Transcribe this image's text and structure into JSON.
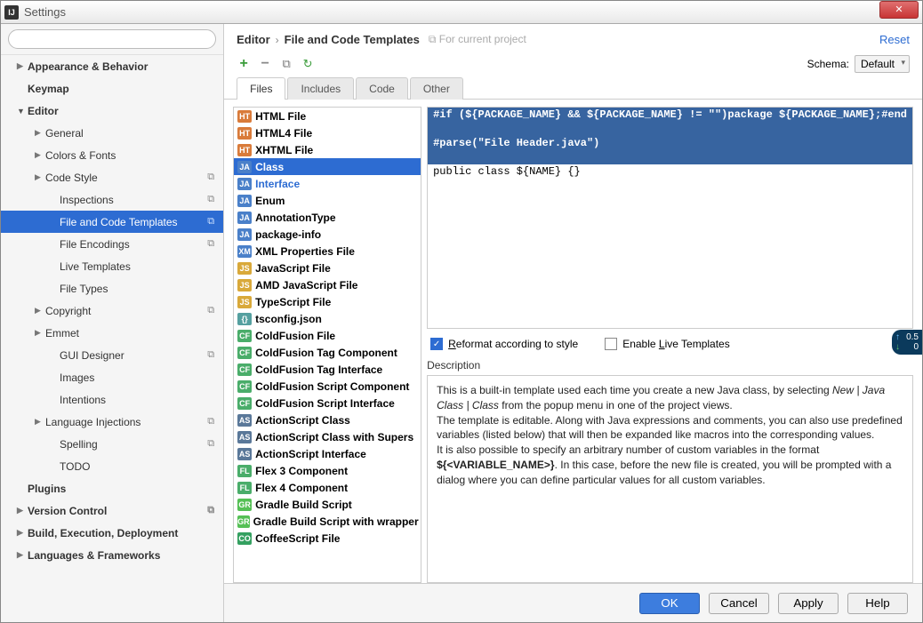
{
  "window": {
    "title": "Settings"
  },
  "breadcrumb": {
    "part1": "Editor",
    "part2": "File and Code Templates",
    "scope": "For current project",
    "reset": "Reset"
  },
  "toolbar": {
    "schema_label": "Schema:",
    "schema_value": "Default"
  },
  "tabs": [
    "Files",
    "Includes",
    "Code",
    "Other"
  ],
  "sidebar": [
    {
      "label": "Appearance & Behavior",
      "lvl": 1,
      "arrow": "▶"
    },
    {
      "label": "Keymap",
      "lvl": 1,
      "arrow": ""
    },
    {
      "label": "Editor",
      "lvl": 1,
      "arrow": "▼"
    },
    {
      "label": "General",
      "lvl": 2,
      "arrow": "▶"
    },
    {
      "label": "Colors & Fonts",
      "lvl": 2,
      "arrow": "▶"
    },
    {
      "label": "Code Style",
      "lvl": 2,
      "arrow": "▶",
      "badge": "⧉"
    },
    {
      "label": "Inspections",
      "lvl": 3,
      "arrow": "",
      "badge": "⧉"
    },
    {
      "label": "File and Code Templates",
      "lvl": 3,
      "arrow": "",
      "badge": "⧉",
      "selected": true
    },
    {
      "label": "File Encodings",
      "lvl": 3,
      "arrow": "",
      "badge": "⧉"
    },
    {
      "label": "Live Templates",
      "lvl": 3,
      "arrow": ""
    },
    {
      "label": "File Types",
      "lvl": 3,
      "arrow": ""
    },
    {
      "label": "Copyright",
      "lvl": 2,
      "arrow": "▶",
      "badge": "⧉"
    },
    {
      "label": "Emmet",
      "lvl": 2,
      "arrow": "▶"
    },
    {
      "label": "GUI Designer",
      "lvl": 3,
      "arrow": "",
      "badge": "⧉"
    },
    {
      "label": "Images",
      "lvl": 3,
      "arrow": ""
    },
    {
      "label": "Intentions",
      "lvl": 3,
      "arrow": ""
    },
    {
      "label": "Language Injections",
      "lvl": 2,
      "arrow": "▶",
      "badge": "⧉"
    },
    {
      "label": "Spelling",
      "lvl": 3,
      "arrow": "",
      "badge": "⧉"
    },
    {
      "label": "TODO",
      "lvl": 3,
      "arrow": ""
    },
    {
      "label": "Plugins",
      "lvl": 1,
      "arrow": ""
    },
    {
      "label": "Version Control",
      "lvl": 1,
      "arrow": "▶",
      "badge": "⧉"
    },
    {
      "label": "Build, Execution, Deployment",
      "lvl": 1,
      "arrow": "▶"
    },
    {
      "label": "Languages & Frameworks",
      "lvl": 1,
      "arrow": "▶"
    }
  ],
  "templates": [
    {
      "label": "HTML File",
      "ico": "html"
    },
    {
      "label": "HTML4 File",
      "ico": "html"
    },
    {
      "label": "XHTML File",
      "ico": "html"
    },
    {
      "label": "Class",
      "ico": "java",
      "selected": true
    },
    {
      "label": "Interface",
      "ico": "java",
      "link": true
    },
    {
      "label": "Enum",
      "ico": "java"
    },
    {
      "label": "AnnotationType",
      "ico": "java"
    },
    {
      "label": "package-info",
      "ico": "java"
    },
    {
      "label": "XML Properties File",
      "ico": "xml"
    },
    {
      "label": "JavaScript File",
      "ico": "js"
    },
    {
      "label": "AMD JavaScript File",
      "ico": "js"
    },
    {
      "label": "TypeScript File",
      "ico": "js"
    },
    {
      "label": "tsconfig.json",
      "ico": "json"
    },
    {
      "label": "ColdFusion File",
      "ico": "cf"
    },
    {
      "label": "ColdFusion Tag Component",
      "ico": "cf"
    },
    {
      "label": "ColdFusion Tag Interface",
      "ico": "cf"
    },
    {
      "label": "ColdFusion Script Component",
      "ico": "cf"
    },
    {
      "label": "ColdFusion Script Interface",
      "ico": "cf"
    },
    {
      "label": "ActionScript Class",
      "ico": "as"
    },
    {
      "label": "ActionScript Class with Supers",
      "ico": "as"
    },
    {
      "label": "ActionScript Interface",
      "ico": "as"
    },
    {
      "label": "Flex 3 Component",
      "ico": "flex"
    },
    {
      "label": "Flex 4 Component",
      "ico": "flex"
    },
    {
      "label": "Gradle Build Script",
      "ico": "gradle"
    },
    {
      "label": "Gradle Build Script with wrapper",
      "ico": "gradle"
    },
    {
      "label": "CoffeeScript File",
      "ico": "coffee"
    }
  ],
  "code": {
    "line1": "#if (${PACKAGE_NAME} && ${PACKAGE_NAME} != \"\")package ${PACKAGE_NAME};#end",
    "line2": "#parse(\"File Header.java\")",
    "line3": "public class ${NAME} {}"
  },
  "options": {
    "reformat_pre": "R",
    "reformat_rest": "eformat according to style",
    "live_pre": "Enable ",
    "live_u": "L",
    "live_rest": "ive Templates"
  },
  "desc": {
    "label": "Description",
    "p1a": "This is a built-in template used each time you create a new Java class, by selecting ",
    "p1b": "New | Java Class | Class",
    "p1c": " from the popup menu in one of the project views.",
    "p2": "The template is editable. Along with Java expressions and comments, you can also use predefined variables (listed below) that will then be expanded like macros into the corresponding values.",
    "p3a": "It is also possible to specify an arbitrary number of custom variables in the format ",
    "p3b": "${<VARIABLE_NAME>}",
    "p3c": ". In this case, before the new file is created, you will be prompted with a dialog where you can define particular values for all custom variables."
  },
  "footer": {
    "ok": "OK",
    "cancel": "Cancel",
    "apply": "Apply",
    "help": "Help"
  },
  "float": {
    "up": "0.5",
    "dn": "0"
  }
}
